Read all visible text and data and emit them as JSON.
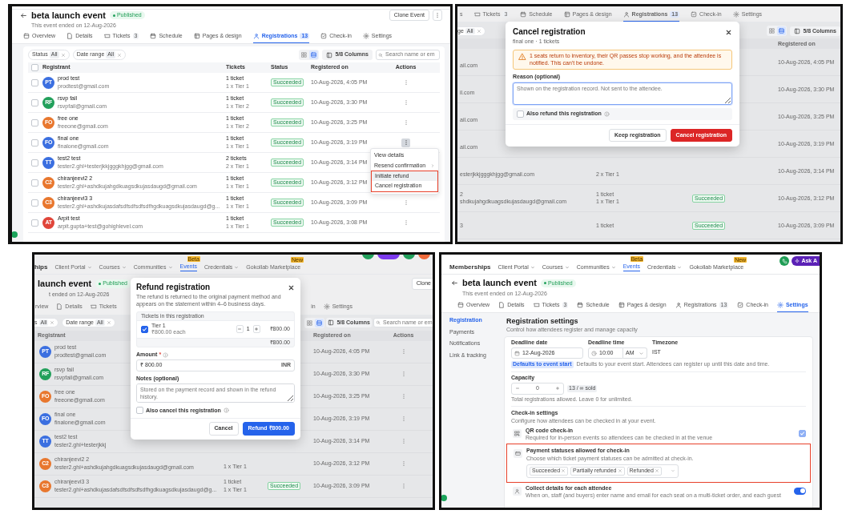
{
  "panels": [
    {
      "kind": "registrations",
      "event": {
        "back": true,
        "title": "beta launch event",
        "status": "Published",
        "subtitle": "This event ended on 12-Aug-2026"
      },
      "clone_button": "Clone Event",
      "more_button": true,
      "tabs": [
        {
          "label": "Overview",
          "kind": "overview",
          "selected": false
        },
        {
          "label": "Details",
          "kind": "details",
          "selected": false
        },
        {
          "label": "Tickets",
          "kind": "tickets",
          "count": "3",
          "selected": false
        },
        {
          "label": "Schedule",
          "kind": "schedule",
          "selected": false
        },
        {
          "label": "Pages & design",
          "kind": "pages",
          "selected": false
        },
        {
          "label": "Registrations",
          "kind": "registrations",
          "count": "13",
          "selected": true
        },
        {
          "label": "Check-in",
          "kind": "checkin",
          "selected": false
        },
        {
          "label": "Settings",
          "kind": "settings",
          "selected": false
        }
      ],
      "filters": [
        {
          "label": "Status",
          "value": "All"
        },
        {
          "label": "Date range",
          "value": "All"
        }
      ],
      "views": [
        {
          "kind": "grid",
          "selected": false
        },
        {
          "kind": "list",
          "selected": true
        }
      ],
      "columns_button": "5/8 Columns",
      "search": {
        "placeholder": "Search name or em"
      },
      "table": {
        "select_all": {
          "checked": false
        },
        "columns": {
          "registrant": "Registrant",
          "tickets": "Tickets",
          "status": "Status",
          "registered_on": "Registered on",
          "actions": "Actions"
        },
        "rows": [
          {
            "checked": false,
            "initials": "PT",
            "color": "#3b6fe0",
            "name": "prod test",
            "email": "prodtest@gmail.com",
            "tickets": "1 ticket",
            "tickets_detail": "1 x Tier 1",
            "status": "Succeeded",
            "registered_on": "10-Aug-2026, 4:05 PM",
            "menu_open": false
          },
          {
            "checked": false,
            "initials": "RF",
            "color": "#22a05b",
            "name": "rsvp fail",
            "email": "rsvpfail@gmail.com",
            "tickets": "1 ticket",
            "tickets_detail": "1 x Tier 2",
            "status": "Succeeded",
            "registered_on": "10-Aug-2026, 3:30 PM",
            "menu_open": false
          },
          {
            "checked": false,
            "initials": "FO",
            "color": "#e8772e",
            "name": "free one",
            "email": "freeone@gmail.com",
            "tickets": "1 ticket",
            "tickets_detail": "1 x Tier 2",
            "status": "Succeeded",
            "registered_on": "10-Aug-2026, 3:25 PM",
            "menu_open": false
          },
          {
            "checked": false,
            "initials": "FO",
            "color": "#3b6fe0",
            "name": "final one",
            "email": "finalone@gmail.com",
            "tickets": "1 ticket",
            "tickets_detail": "1 x Tier 1",
            "status": "Succeeded",
            "registered_on": "10-Aug-2026, 3:19 PM",
            "menu_open": true
          },
          {
            "checked": false,
            "initials": "TT",
            "color": "#3b6fe0",
            "name": "test2 test",
            "email": "tester2.ghl+testerjkkjgggkhjgg@gmail.com",
            "tickets": "2 tickets",
            "tickets_detail": "2 x Tier 1",
            "status": "Succeeded",
            "registered_on": "10-Aug-2026, 3:14 PM"
          },
          {
            "checked": false,
            "initials": "C2",
            "color": "#e8772e",
            "name": "chiranjeevi2 2",
            "email": "tester2.ghl+ashdkujahgdkuagsdkujasdaugd@gmail.com",
            "tickets": "1 ticket",
            "tickets_detail": "1 x Tier 1",
            "status": "Succeeded",
            "registered_on": "10-Aug-2026, 3:12 PM"
          },
          {
            "checked": false,
            "initials": "C3",
            "color": "#e8772e",
            "name": "chiranjeevi3 3",
            "email": "tester2.ghl+ashdkujasdafsdfsdfsdfsdfhgdkuagsdkujasdaugd@g...",
            "tickets": "1 ticket",
            "tickets_detail": "1 x Tier 1",
            "status": "Succeeded",
            "registered_on": "10-Aug-2026, 3:09 PM",
            "menu_open": false
          },
          {
            "checked": false,
            "initials": "AT",
            "color": "#e0453a",
            "name": "Arpit test",
            "email": "arpit.gupta+test@gohighlevel.com",
            "tickets": "1 ticket",
            "tickets_detail": "1 x Tier 1",
            "status": "Succeeded",
            "registered_on": "10-Aug-2026, 3:08 PM",
            "menu_open": false
          }
        ]
      },
      "row_menu": {
        "items": [
          {
            "label": "View details",
            "submenu": false,
            "highlighted": false,
            "annotated": false
          },
          {
            "label": "Resend confirmation",
            "submenu": true,
            "highlighted": false,
            "annotated": false
          },
          {
            "label": "Initiate refund",
            "submenu": false,
            "highlighted": true,
            "annotated": true
          },
          {
            "label": "Cancel registration",
            "submenu": false,
            "highlighted": false,
            "annotated": true
          }
        ]
      }
    },
    {
      "kind": "cancel_dialog",
      "background": {
        "tabs": [
          {
            "label": "s",
            "kind": "none",
            "selected": false
          },
          {
            "label": "Tickets",
            "kind": "tickets",
            "count": "3",
            "selected": false
          },
          {
            "label": "Schedule",
            "kind": "schedule",
            "selected": false
          },
          {
            "label": "Pages & design",
            "kind": "pages",
            "selected": false
          },
          {
            "label": "Registrations",
            "kind": "registrations",
            "count": "13",
            "selected": true
          },
          {
            "label": "Check-in",
            "kind": "checkin",
            "selected": false
          },
          {
            "label": "Settings",
            "kind": "settings",
            "selected": false
          }
        ],
        "filters": [
          {
            "label": "ge",
            "value": "All"
          }
        ],
        "views": [
          {
            "kind": "grid",
            "selected": false
          },
          {
            "kind": "list",
            "selected": true
          }
        ],
        "columns_button": "5/8 Columns",
        "table": {
          "columns": {
            "registered_on": "Registered on"
          },
          "rows": [
            {
              "email": "ail.com",
              "registered_on": "10-Aug-2026, 4:05 PM"
            },
            {
              "email": "il.com",
              "registered_on": "10-Aug-2026, 3:30 PM"
            },
            {
              "email": "ail.com",
              "registered_on": "10-Aug-2026, 3:25 PM"
            },
            {
              "email": "ail.com",
              "registered_on": "10-Aug-2026, 3:19 PM"
            },
            {
              "email": "esterjkkjgggkhjgg@gmail.com",
              "tickets_detail": "2 x Tier 1",
              "registered_on": "10-Aug-2026, 3:14 PM"
            },
            {
              "name": "2",
              "email": "shdkujahgdkuagsdkujasdaugd@gmail.com",
              "tickets": "1 ticket",
              "tickets_detail": "1 x Tier 1",
              "status": "Succeeded",
              "registered_on": "10-Aug-2026, 3:12 PM"
            },
            {
              "name": "3",
              "tickets": "1 ticket",
              "status": "Succeeded",
              "registered_on": "10-Aug-2026, 3:09 PM"
            }
          ]
        }
      },
      "dialog": {
        "title": "Cancel registration",
        "subtitle": "final one · 1 tickets",
        "warning": "1 seats return to inventory, their QR passes stop working, and the attendee is notified. This can't be undone.",
        "reason": {
          "label": "Reason (optional)",
          "placeholder": "Shown on the registration record. Not sent to the attendee.",
          "focused": true
        },
        "option": {
          "label": "Also refund this registration",
          "checked": false
        },
        "buttons": [
          {
            "label": "Keep registration",
            "kind": "secondary"
          },
          {
            "label": "Cancel registration",
            "kind": "danger"
          }
        ]
      }
    },
    {
      "kind": "refund_dialog",
      "background": {
        "nav": [
          {
            "label": "hips",
            "kind": "brand"
          },
          {
            "label": "Client Portal",
            "kind": "link",
            "dropdown": true,
            "selected": false
          },
          {
            "label": "Courses",
            "kind": "link",
            "dropdown": true,
            "selected": false
          },
          {
            "label": "Communities",
            "kind": "link",
            "dropdown": true,
            "selected": false
          },
          {
            "label": "Events",
            "kind": "link",
            "dropdown": false,
            "selected": true,
            "badge": "Beta"
          },
          {
            "label": "Credentials",
            "kind": "link",
            "dropdown": true,
            "selected": false
          },
          {
            "label": "Gokollab Marketplace",
            "kind": "link",
            "dropdown": false,
            "selected": false,
            "badge": "New"
          }
        ],
        "event": {
          "title": "launch event",
          "status": "Published",
          "subtitle": "t ended on 12-Aug-2026"
        },
        "clone_button": "Clone",
        "tabs": [
          {
            "label": "rview",
            "kind": "none",
            "selected": false
          },
          {
            "label": "Details",
            "kind": "details",
            "selected": false
          },
          {
            "label": "Tickets",
            "kind": "tickets",
            "selected": false
          },
          {
            "label": "in",
            "kind": "none",
            "selected": false
          },
          {
            "label": "Settings",
            "kind": "settings",
            "selected": false
          }
        ],
        "filters": [
          {
            "label": "s",
            "value": "All"
          },
          {
            "label": "Date range",
            "value": "All"
          }
        ],
        "views": [
          {
            "kind": "grid",
            "selected": false
          },
          {
            "kind": "list",
            "selected": true
          }
        ],
        "columns_button": "5/8 Columns",
        "search": {
          "placeholder": "Search name or em"
        },
        "table": {
          "columns": {
            "registrant": "Registrant",
            "registered_on": "Registered on",
            "actions": "Actions"
          },
          "rows": [
            {
              "initials": "PT",
              "color": "#3b6fe0",
              "name": "prod test",
              "email": "prodtest@gmail.com",
              "registered_on": "10-Aug-2026, 4:05 PM",
              "menu_open": false
            },
            {
              "initials": "RF",
              "color": "#22a05b",
              "name": "rsvp fail",
              "email": "rsvpfail@gmail.com",
              "registered_on": "10-Aug-2026, 3:30 PM",
              "menu_open": false
            },
            {
              "initials": "FO",
              "color": "#e8772e",
              "name": "free one",
              "email": "freeone@gmail.com",
              "registered_on": "10-Aug-2026, 3:25 PM",
              "menu_open": false
            },
            {
              "initials": "FO",
              "color": "#3b6fe0",
              "name": "final one",
              "email": "finalone@gmail.com",
              "registered_on": "10-Aug-2026, 3:19 PM",
              "menu_open": false
            },
            {
              "initials": "TT",
              "color": "#3b6fe0",
              "name": "test2 test",
              "email": "tester2.ghl+testerjkkj",
              "registered_on": "10-Aug-2026, 3:14 PM",
              "menu_open": false
            },
            {
              "initials": "C2",
              "color": "#e8772e",
              "name": "chiranjeevi2 2",
              "email": "tester2.ghl+ashdkujahgdkuagsdkujasdaugd@gmail.com",
              "tickets_detail": "1 x Tier 1",
              "registered_on": "10-Aug-2026, 3:12 PM",
              "menu_open": false
            },
            {
              "initials": "C3",
              "color": "#e8772e",
              "name": "chiranjeevi3 3",
              "email": "tester2.ghl+ashdkujasdafsdfsdfsdfsdfhgdkuagsdkujasdaugd@g...",
              "tickets": "1 ticket",
              "tickets_detail": "1 x Tier 1",
              "status": "Succeeded",
              "registered_on": "10-Aug-2026, 3:09 PM",
              "menu_open": false
            }
          ]
        }
      },
      "dialog": {
        "title": "Refund registration",
        "description": "The refund is returned to the original payment method and appears on the statement within 4–6 business days.",
        "tickets": {
          "header": "Tickets in this registration",
          "items": [
            {
              "name": "Tier 1",
              "price": "₹800.00 each",
              "checked": true,
              "quantity": "1",
              "amount": "₹800.00"
            }
          ],
          "total": "₹800.00"
        },
        "amount": {
          "label": "Amount",
          "required_mark": "*",
          "prefix": "₹",
          "value": "800.00",
          "currency": "INR"
        },
        "notes": {
          "label": "Notes (optional)",
          "placeholder": "Stored on the payment record and shown in the refund history."
        },
        "option": {
          "label": "Also cancel this registration",
          "checked": false
        },
        "buttons": [
          {
            "label": "Cancel",
            "kind": "secondary"
          },
          {
            "label": "Refund ₹800.00",
            "kind": "primary"
          }
        ]
      }
    },
    {
      "kind": "settings",
      "nav": [
        {
          "label": "Memberships",
          "kind": "brand"
        },
        {
          "label": "Client Portal",
          "kind": "link",
          "dropdown": true,
          "selected": false
        },
        {
          "label": "Courses",
          "kind": "link",
          "dropdown": true,
          "selected": false
        },
        {
          "label": "Communities",
          "kind": "link",
          "dropdown": true,
          "selected": false
        },
        {
          "label": "Events",
          "kind": "link",
          "dropdown": false,
          "selected": true,
          "badge": "Beta"
        },
        {
          "label": "Credentials",
          "kind": "link",
          "dropdown": true,
          "selected": false
        },
        {
          "label": "Gokollab Marketplace",
          "kind": "link",
          "dropdown": false,
          "selected": false,
          "badge": "New"
        }
      ],
      "ask_button": "Ask A",
      "event": {
        "back": true,
        "title": "beta launch event",
        "status": "Published",
        "subtitle": "This event ended on 12-Aug-2026"
      },
      "tabs": [
        {
          "label": "Overview",
          "kind": "overview",
          "selected": false
        },
        {
          "label": "Details",
          "kind": "details",
          "selected": false
        },
        {
          "label": "Tickets",
          "kind": "tickets",
          "count": "3",
          "selected": false
        },
        {
          "label": "Schedule",
          "kind": "schedule",
          "selected": false
        },
        {
          "label": "Pages & design",
          "kind": "pages",
          "selected": false
        },
        {
          "label": "Registrations",
          "kind": "registrations",
          "count": "13",
          "selected": false
        },
        {
          "label": "Check-in",
          "kind": "checkin",
          "selected": false
        },
        {
          "label": "Settings",
          "kind": "settings",
          "selected": true
        }
      ],
      "settings_menu": [
        {
          "label": "Registration",
          "selected": true
        },
        {
          "label": "Payments",
          "selected": false
        },
        {
          "label": "Notifications",
          "selected": false
        },
        {
          "label": "Link & tracking",
          "selected": false
        }
      ],
      "section": {
        "title": "Registration settings",
        "description": "Control how attendees register and manage capacity"
      },
      "deadline_date": {
        "label": "Deadline date",
        "value": "12-Aug-2026"
      },
      "deadline_time": {
        "label": "Deadline time",
        "value": "10:00",
        "period": "AM"
      },
      "timezone": {
        "label": "Timezone",
        "value": "IST"
      },
      "deadline_badge": "Defaults to event start",
      "deadline_hint": "Defaults to your event start. Attendees can register up until this date and time.",
      "capacity": {
        "label": "Capacity",
        "value": "0",
        "sold": "13 / ∞ sold",
        "hint": "Total registrations allowed. Leave 0 for unlimited."
      },
      "checkin": {
        "title": "Check-in settings",
        "description": "Configure how attendees can be checked in at your event.",
        "options": [
          {
            "kind": "checkbox",
            "title": "QR code check-in",
            "description": "Required for in-person events so attendees can be checked in at the venue",
            "checked": true,
            "annotated": false
          },
          {
            "kind": "multiselect",
            "title": "Payment statuses allowed for check-in",
            "description": "Choose which ticket payment statuses can be admitted at check-in.",
            "chips": [
              "Succeeded",
              "Partially refunded",
              "Refunded"
            ],
            "annotated": true
          },
          {
            "kind": "toggle",
            "title": "Collect details for each attendee",
            "description": "When on, staff (and buyers) enter name and email for each seat on a multi-ticket order, and each guest",
            "on": true,
            "annotated": false
          }
        ]
      }
    }
  ]
}
